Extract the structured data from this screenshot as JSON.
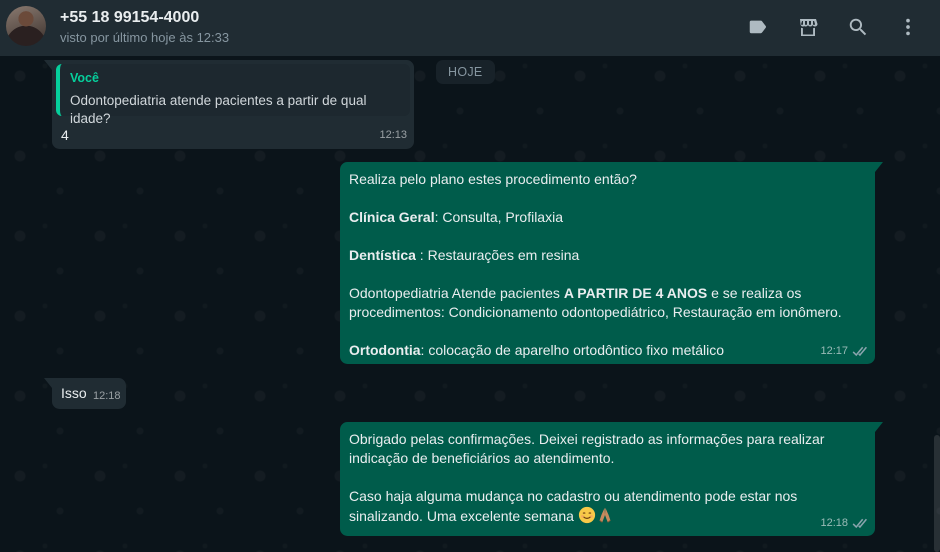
{
  "header": {
    "contact_name": "+55 18 99154-4000",
    "status": "visto por último hoje às 12:33",
    "icons": [
      "label-icon",
      "catalog-store-icon",
      "search-icon",
      "menu-icon"
    ]
  },
  "chat": {
    "day_label": "HOJE",
    "messages": [
      {
        "direction": "in",
        "quote_author": "Você",
        "quote_text": "Odontopediatria atende pacientes a partir de qual idade?",
        "text": "4",
        "time": "12:13"
      },
      {
        "direction": "out",
        "line1": "Realiza pelo plano estes procedimento então?",
        "clinica_label": "Clínica Geral",
        "clinica_text": ": Consulta, Profilaxia",
        "dentistica_label": "Dentística",
        "dentistica_text": " : Restaurações em resina",
        "odonto_pre": "Odontopediatria Atende pacientes ",
        "odonto_bold": "A PARTIR DE 4 ANOS",
        "odonto_post": " e se realiza os procedimentos: Condicionamento odontopediátrico, Restauração em ionômero.",
        "orto_label": "Ortodontia",
        "orto_text": ": colocação de aparelho ortodôntico fixo metálico",
        "time": "12:17",
        "status": "read"
      },
      {
        "direction": "in",
        "text": "Isso",
        "time": "12:18"
      },
      {
        "direction": "out",
        "para1": "Obrigado pelas confirmações. Deixei registrado as informações para realizar indicação de beneficiários ao atendimento.",
        "para2": "Caso haja alguma mudança no cadastro ou atendimento pode estar nos sinalizando. Uma excelente semana",
        "emojis": [
          "smiling-face-icon",
          "folded-hands-icon"
        ],
        "time": "12:18",
        "status": "read"
      }
    ]
  },
  "colors": {
    "header_bg": "#202c33",
    "chat_bg": "#0b141a",
    "incoming_bubble": "#202c33",
    "outgoing_bubble": "#005c4b",
    "quote_accent": "#06cf9c",
    "secondary_text": "#8696a0"
  }
}
